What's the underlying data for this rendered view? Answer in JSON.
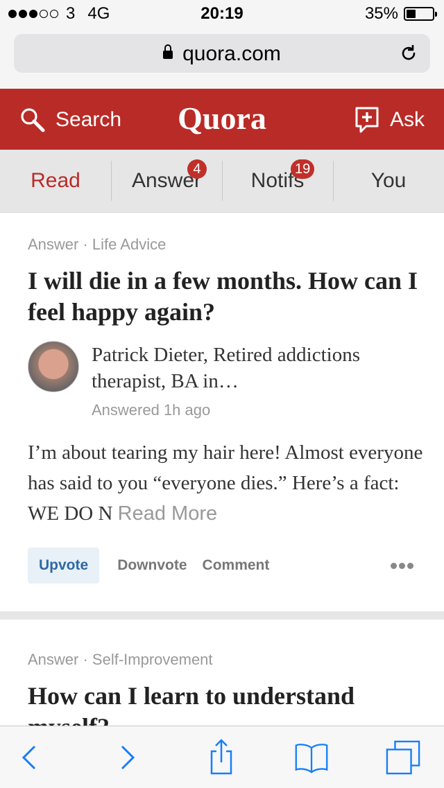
{
  "status_bar": {
    "carrier": "3",
    "network": "4G",
    "time": "20:19",
    "battery_text": "35%",
    "battery_level": 0.35,
    "signal_strength": 3,
    "signal_max": 5
  },
  "browser": {
    "url": "quora.com"
  },
  "header": {
    "search_label": "Search",
    "logo_text": "Quora",
    "ask_label": "Ask",
    "brand_color": "#b92b27"
  },
  "tabs": [
    {
      "label": "Read",
      "badge": ""
    },
    {
      "label": "Answer",
      "badge": "4"
    },
    {
      "label": "Notifs",
      "badge": "19"
    },
    {
      "label": "You",
      "badge": ""
    }
  ],
  "feed": [
    {
      "meta": "Answer · Life Advice",
      "title": "I will die in a few months. How can I feel happy again?",
      "author": "Patrick Dieter, Retired addictions therapist, BA in…",
      "answered": "Answered 1h ago",
      "excerpt": "I’m about tearing my hair here! Almost everyone has said to you “everyone dies.” Here’s a fact: WE DO N",
      "read_more": "Read More",
      "actions": {
        "upvote": "Upvote",
        "downvote": "Downvote",
        "comment": "Comment"
      }
    },
    {
      "meta": "Answer · Self-Improvement",
      "title": "How can I learn to understand myself?"
    }
  ],
  "toolbar": {
    "icons": [
      "back-icon",
      "forward-icon",
      "share-icon",
      "bookmarks-icon",
      "tabs-icon"
    ],
    "accent": "#157efb"
  }
}
